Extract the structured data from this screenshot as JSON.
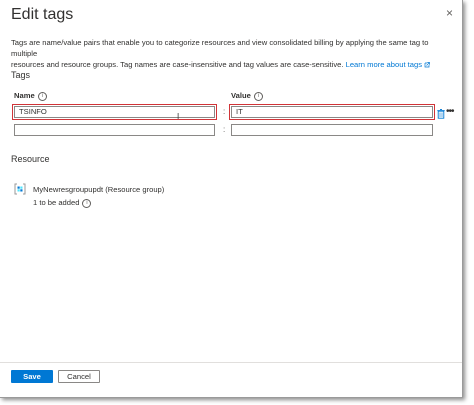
{
  "header": {
    "title": "Edit tags",
    "close_label": "×"
  },
  "description": {
    "line1": "Tags are name/value pairs that enable you to categorize resources and view consolidated billing by applying the same tag to multiple",
    "line2": "resources and resource groups. Tag names are case-insensitive and tag values are case-sensitive.",
    "link": "Learn more about tags"
  },
  "tags": {
    "section_label": "Tags",
    "name_header": "Name",
    "value_header": "Value",
    "separator": ":",
    "rows": [
      {
        "name": "TSINFO",
        "value": "IT"
      },
      {
        "name": "",
        "value": ""
      }
    ]
  },
  "resource": {
    "section_label": "Resource",
    "name": "MyNewresgroupupdt",
    "type": "(Resource group)",
    "status": "1 to be added"
  },
  "footer": {
    "save_label": "Save",
    "cancel_label": "Cancel"
  },
  "colors": {
    "primary": "#0078d4",
    "highlight": "#d13438"
  }
}
